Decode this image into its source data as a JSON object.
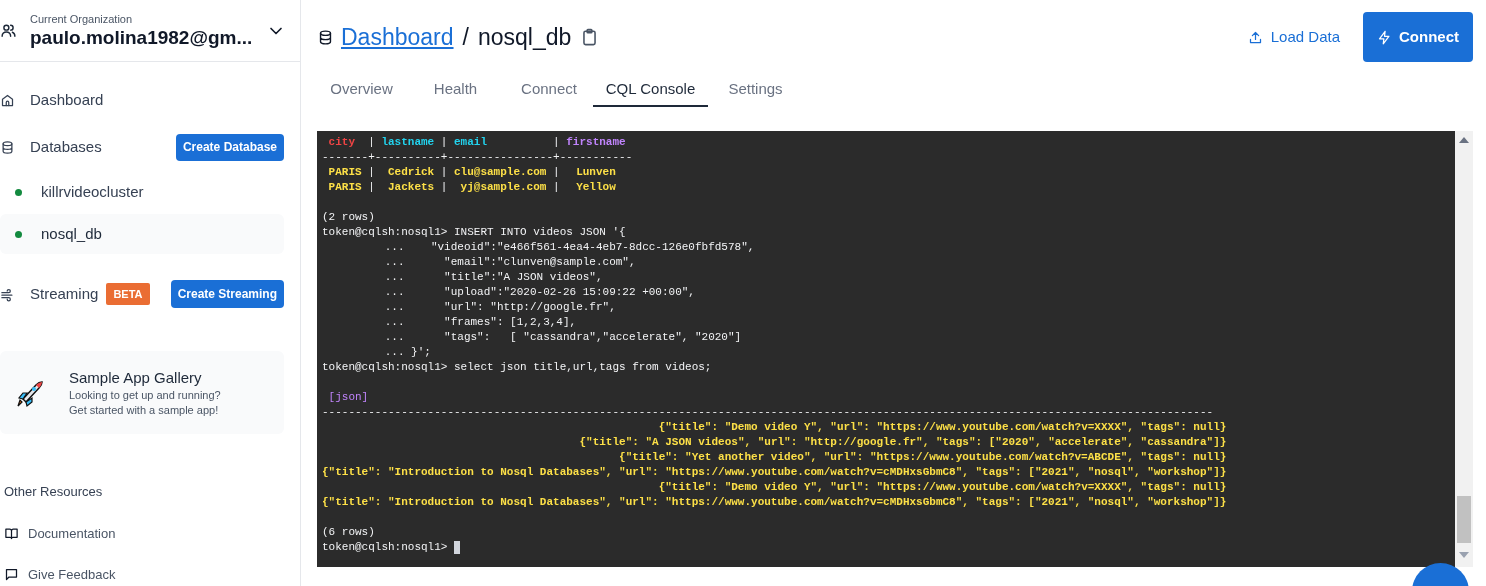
{
  "organization": {
    "label": "Current Organization",
    "name": "paulo.molina1982@gm..."
  },
  "sidebar": {
    "nav": [
      {
        "kind": "home",
        "label": "Dashboard"
      }
    ],
    "databases": {
      "label": "Databases",
      "button": "Create Database",
      "items": [
        {
          "name": "killrvideocluster",
          "selected": false
        },
        {
          "name": "nosql_db",
          "selected": true
        }
      ]
    },
    "streaming": {
      "label": "Streaming",
      "badge": "BETA",
      "button": "Create Streaming"
    },
    "sample_app": {
      "title": "Sample App Gallery",
      "lines": [
        "Looking to get up and running?",
        "Get started with a sample app!"
      ]
    },
    "other_resources": {
      "heading": "Other Resources",
      "links": [
        {
          "kind": "book",
          "label": "Documentation"
        },
        {
          "kind": "chat",
          "label": "Give Feedback"
        }
      ]
    }
  },
  "header": {
    "breadcrumb": {
      "link": "Dashboard",
      "separator": "/",
      "current": "nosql_db"
    },
    "load_data": "Load Data",
    "connect": "Connect"
  },
  "tabs": [
    {
      "label": "Overview",
      "selected": false
    },
    {
      "label": "Health",
      "selected": false
    },
    {
      "label": "Connect",
      "selected": false
    },
    {
      "label": "CQL Console",
      "selected": true
    },
    {
      "label": "Settings",
      "selected": false
    }
  ],
  "console": {
    "column_divider": "|",
    "lines": [
      {
        "kind": "table_header",
        "cells": [
          {
            "text": "city",
            "color": "#ef4444"
          },
          {
            "text": "lastname",
            "color": "#22d3ee"
          },
          {
            "text": "email",
            "color": "#22d3ee"
          },
          {
            "text": "firstname",
            "color": "#c084fc"
          }
        ]
      },
      {
        "kind": "separator",
        "text": "-------+----------+----------------+-----------"
      },
      {
        "kind": "table_row",
        "cells": [
          "PARIS",
          "Cedrick",
          "clu@sample.com",
          "Lunven"
        ]
      },
      {
        "kind": "table_row",
        "cells": [
          "PARIS",
          "Jackets",
          "yj@sample.com",
          "Yellow"
        ]
      },
      {
        "kind": "blank"
      },
      {
        "kind": "output",
        "text": "(2 rows)"
      },
      {
        "kind": "prompt",
        "prompt": "token@cqlsh:nosql1>",
        "command": "INSERT INTO videos JSON '{"
      },
      {
        "kind": "continuation",
        "text": "...    \"videoid\":\"e466f561-4ea4-4eb7-8dcc-126e0fbfd578\","
      },
      {
        "kind": "continuation",
        "text": "...      \"email\":\"clunven@sample.com\","
      },
      {
        "kind": "continuation",
        "text": "...      \"title\":\"A JSON videos\","
      },
      {
        "kind": "continuation",
        "text": "...      \"upload\":\"2020-02-26 15:09:22 +00:00\","
      },
      {
        "kind": "continuation",
        "text": "...      \"url\": \"http://google.fr\","
      },
      {
        "kind": "continuation",
        "text": "...      \"frames\": [1,2,3,4],"
      },
      {
        "kind": "continuation",
        "text": "...      \"tags\":   [ \"cassandra\",\"accelerate\", \"2020\"]"
      },
      {
        "kind": "continuation",
        "text": "... }';"
      },
      {
        "kind": "prompt",
        "prompt": "token@cqlsh:nosql1>",
        "command": "select json title,url,tags from videos;"
      },
      {
        "kind": "blank"
      },
      {
        "kind": "json_result",
        "header": "[json]",
        "separator": "---------------------------------------------------------------------------------------------------------------------------------------",
        "rows": [
          "{\"title\": \"Demo video Y\", \"url\": \"https://www.youtube.com/watch?v=XXXX\", \"tags\": null}",
          "{\"title\": \"A JSON videos\", \"url\": \"http://google.fr\", \"tags\": [\"2020\", \"accelerate\", \"cassandra\"]}",
          "{\"title\": \"Yet another video\", \"url\": \"https://www.youtube.com/watch?v=ABCDE\", \"tags\": null}",
          "{\"title\": \"Introduction to Nosql Databases\", \"url\": \"https://www.youtube.com/watch?v=cMDHxsGbmC8\", \"tags\": [\"2021\", \"nosql\", \"workshop\"]}",
          "{\"title\": \"Demo video Y\", \"url\": \"https://www.youtube.com/watch?v=XXXX\", \"tags\": null}",
          "{\"title\": \"Introduction to Nosql Databases\", \"url\": \"https://www.youtube.com/watch?v=cMDHxsGbmC8\", \"tags\": [\"2021\", \"nosql\", \"workshop\"]}"
        ]
      },
      {
        "kind": "blank"
      },
      {
        "kind": "output",
        "text": "(6 rows)"
      },
      {
        "kind": "cursor",
        "prompt": "token@cqlsh:nosql1>"
      }
    ]
  }
}
